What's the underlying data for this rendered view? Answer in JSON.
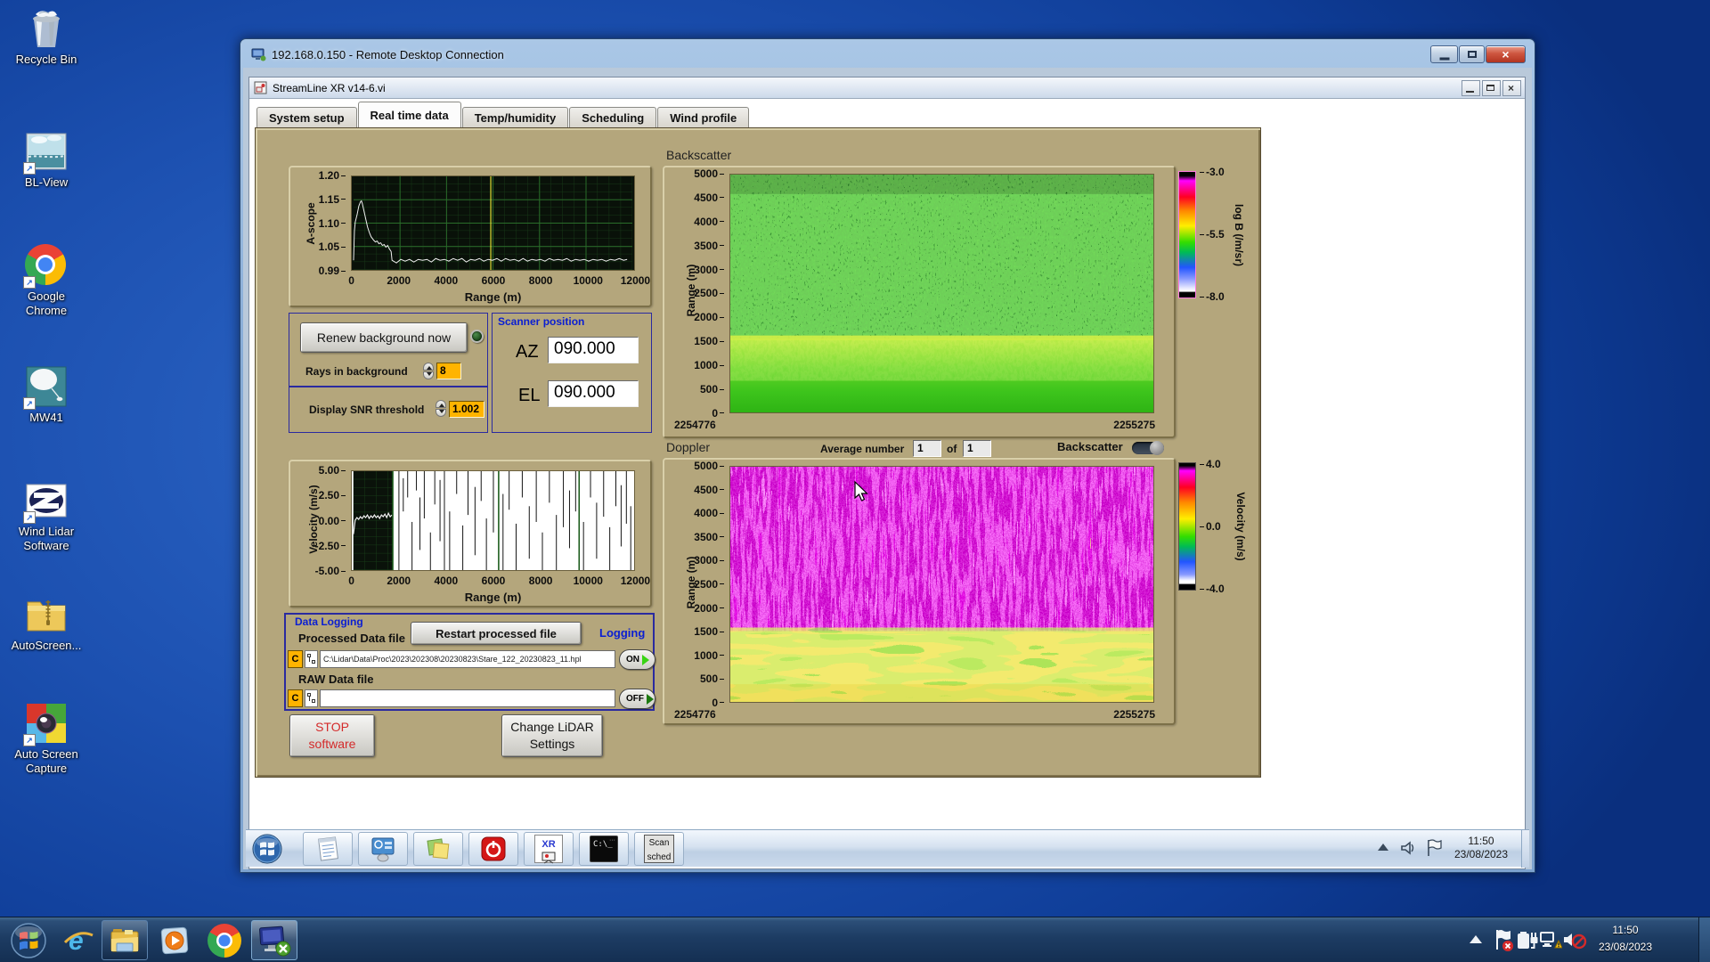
{
  "desktop": {
    "icons": [
      {
        "label": "Recycle Bin",
        "label2": ""
      },
      {
        "label": "BL-View",
        "label2": ""
      },
      {
        "label": "Google",
        "label2": "Chrome"
      },
      {
        "label": "MW41",
        "label2": ""
      },
      {
        "label": "Wind Lidar",
        "label2": "Software"
      },
      {
        "label": "AutoScreen...",
        "label2": ""
      },
      {
        "label": "Auto Screen",
        "label2": "Capture"
      }
    ]
  },
  "rdp": {
    "title": "192.168.0.150 - Remote Desktop Connection"
  },
  "app": {
    "title": "StreamLine XR v14-6.vi",
    "tabs": [
      {
        "label": "System setup"
      },
      {
        "label": "Real time data"
      },
      {
        "label": "Temp/humidity"
      },
      {
        "label": "Scheduling"
      },
      {
        "label": "Wind profile"
      }
    ]
  },
  "ascope": {
    "ylabel": "A-scope",
    "xlabel": "Range (m)",
    "yticks": [
      "1.20",
      "1.15",
      "1.10",
      "1.05",
      "0.99"
    ],
    "xticks": [
      "0",
      "2000",
      "4000",
      "6000",
      "8000",
      "10000",
      "12000"
    ]
  },
  "background_ctrl": {
    "renew_button": "Renew background now",
    "rays_label": "Rays in background",
    "rays_value": "8",
    "snr_label": "Display SNR threshold",
    "snr_value": "1.002"
  },
  "scanner": {
    "title": "Scanner position",
    "az_label": "AZ",
    "az_value": "090.000",
    "el_label": "EL",
    "el_value": "090.000"
  },
  "backscatter": {
    "title": "Backscatter",
    "ylabel": "Range (m)",
    "yticks": [
      "5000",
      "4500",
      "4000",
      "3500",
      "3000",
      "2500",
      "2000",
      "1500",
      "1000",
      "500",
      "0"
    ],
    "t_start": "2254776",
    "t_end": "2255275",
    "cbar_label": "log B (/m/sr)",
    "cbar_ticks": [
      "-3.0",
      "-5.5",
      "-8.0"
    ]
  },
  "doppler": {
    "title": "Doppler",
    "avg_label": "Average number",
    "avg_value": "1",
    "of_label": "of",
    "count_value": "1",
    "toggle_label": "Backscatter",
    "ylabel": "Range (m)",
    "yticks": [
      "5000",
      "4500",
      "4000",
      "3500",
      "3000",
      "2500",
      "2000",
      "1500",
      "1000",
      "500",
      "0"
    ],
    "t_start": "2254776",
    "t_end": "2255275",
    "cbar_label": "Velocity (m/s)",
    "cbar_ticks": [
      "4.0",
      "0.0",
      "-4.0"
    ]
  },
  "velocity": {
    "ylabel": "Velocity (m/s)",
    "xlabel": "Range (m)",
    "yticks": [
      "5.00",
      "2.50",
      "0.00",
      "-2.50",
      "-5.00"
    ],
    "xticks": [
      "0",
      "2000",
      "4000",
      "6000",
      "8000",
      "10000",
      "12000"
    ]
  },
  "logging": {
    "title": "Data Logging",
    "processed_label": "Processed Data file",
    "restart_button": "Restart processed file",
    "logging_label": "Logging",
    "drive_letter": "C",
    "processed_path": "C:\\Lidar\\Data\\Proc\\2023\\202308\\20230823\\Stare_122_20230823_11.hpl",
    "raw_label": "RAW Data file",
    "raw_path": "",
    "on_label": "ON",
    "off_label": "OFF"
  },
  "actions": {
    "stop_line1": "STOP",
    "stop_line2": "software",
    "change_line1": "Change LiDAR",
    "change_line2": "Settings"
  },
  "remote_taskbar": {
    "clock_time": "11:50",
    "clock_date": "23/08/2023",
    "xr_label": "XR",
    "cmd_label": "C:\\_",
    "scan_line1": "Scan",
    "scan_line2": "sched"
  },
  "host_taskbar": {
    "clock_time": "11:50",
    "clock_date": "23/08/2023"
  }
}
